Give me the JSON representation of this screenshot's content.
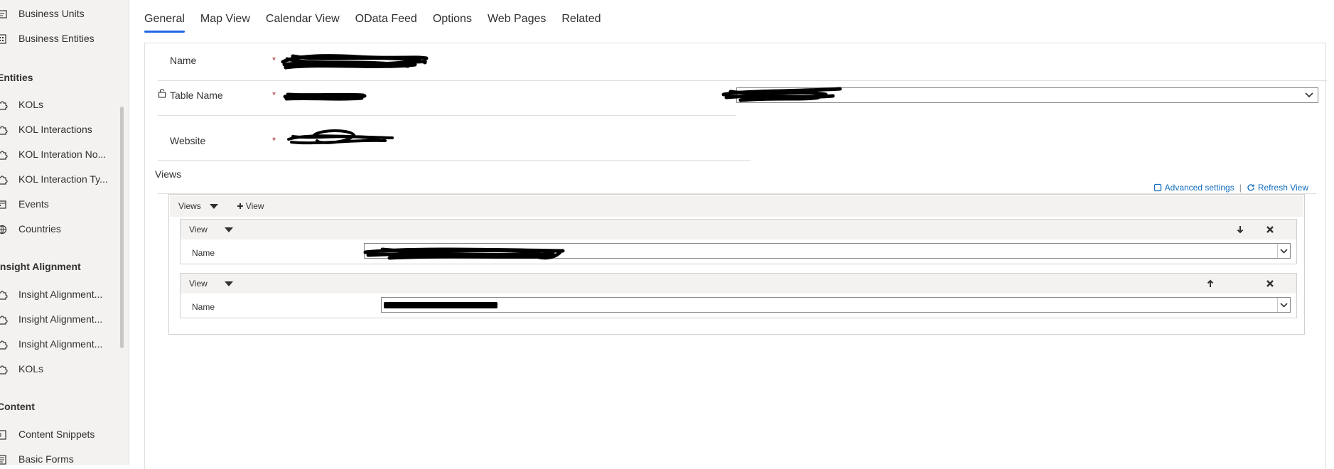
{
  "sidebar": {
    "items_top": [
      {
        "label": "Business Units",
        "icon": "business-unit-icon"
      },
      {
        "label": "Business Entities",
        "icon": "building-icon"
      }
    ],
    "groups": [
      {
        "title": "Entities",
        "items": [
          {
            "label": "KOLs",
            "icon": "puzzle-icon"
          },
          {
            "label": "KOL Interactions",
            "icon": "puzzle-icon"
          },
          {
            "label": "KOL Interation No...",
            "icon": "puzzle-icon"
          },
          {
            "label": "KOL Interaction Ty...",
            "icon": "puzzle-icon"
          },
          {
            "label": "Events",
            "icon": "calendar-icon"
          },
          {
            "label": "Countries",
            "icon": "globe-icon"
          }
        ]
      },
      {
        "title": "Insight Alignment",
        "items": [
          {
            "label": "Insight Alignment...",
            "icon": "puzzle-icon"
          },
          {
            "label": "Insight Alignment...",
            "icon": "puzzle-icon"
          },
          {
            "label": "Insight Alignment...",
            "icon": "puzzle-icon"
          },
          {
            "label": "KOLs",
            "icon": "puzzle-icon"
          }
        ]
      },
      {
        "title": "Content",
        "items": [
          {
            "label": "Content Snippets",
            "icon": "snippet-icon"
          },
          {
            "label": "Basic Forms",
            "icon": "form-icon"
          }
        ]
      }
    ]
  },
  "tabs": [
    "General",
    "Map View",
    "Calendar View",
    "OData Feed",
    "Options",
    "Web Pages",
    "Related"
  ],
  "active_tab": "General",
  "form": {
    "name_label": "Name",
    "table_name_label": "Table Name",
    "website_label": "Website",
    "required_marker": "*",
    "views_label": "Views",
    "advanced_settings": "Advanced settings",
    "separator": "|",
    "refresh_view": "Refresh View",
    "views_header": "Views",
    "add_view": "View",
    "view_blocks": [
      {
        "title": "View",
        "name_label": "Name",
        "move": "down"
      },
      {
        "title": "View",
        "name_label": "Name",
        "move": "up"
      }
    ]
  },
  "colors": {
    "accent": "#2266e3",
    "link": "#0f6cbd",
    "required": "#a4262c",
    "sidebar_bg": "#f3f2f1"
  }
}
